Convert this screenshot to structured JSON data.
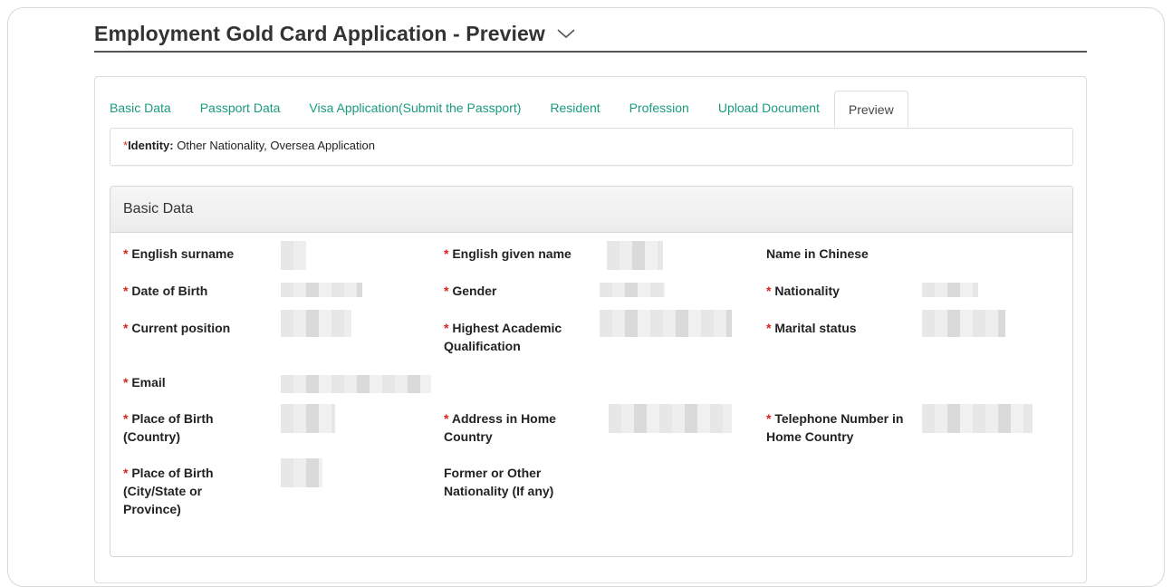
{
  "page": {
    "title": "Employment Gold Card Application - Preview",
    "chevron_icon": "chevron-down-icon"
  },
  "tabs": [
    {
      "label": "Basic Data",
      "active": false
    },
    {
      "label": "Passport Data",
      "active": false
    },
    {
      "label": "Visa Application(Submit the Passport)",
      "active": false
    },
    {
      "label": "Resident",
      "active": false
    },
    {
      "label": "Profession",
      "active": false
    },
    {
      "label": "Upload Document",
      "active": false
    },
    {
      "label": "Preview",
      "active": true
    }
  ],
  "identity": {
    "required_mark": "*",
    "label": "Identity:",
    "value": "Other Nationality, Oversea Application"
  },
  "basic_data": {
    "section_title": "Basic Data",
    "required_mark": "* ",
    "fields": {
      "english_surname": "English surname",
      "english_given_name": "English given name",
      "name_in_chinese": "Name in Chinese",
      "date_of_birth": "Date of Birth",
      "gender": "Gender",
      "nationality": "Nationality",
      "current_position": "Current position",
      "highest_academic_qualification": "Highest Academic Qualification",
      "marital_status": "Marital status",
      "email": "Email",
      "place_of_birth_country": "Place of Birth (Country)",
      "address_in_home_country": "Address in Home Country",
      "telephone_number_in_home_country": "Telephone Number in Home Country",
      "place_of_birth_city": "Place of Birth (City/State or Province)",
      "former_or_other_nationality": "Former or Other Nationality (If any)"
    }
  },
  "colors": {
    "tab_link": "#1a9b7d",
    "required": "#d9251d",
    "title_underline": "#555555"
  }
}
